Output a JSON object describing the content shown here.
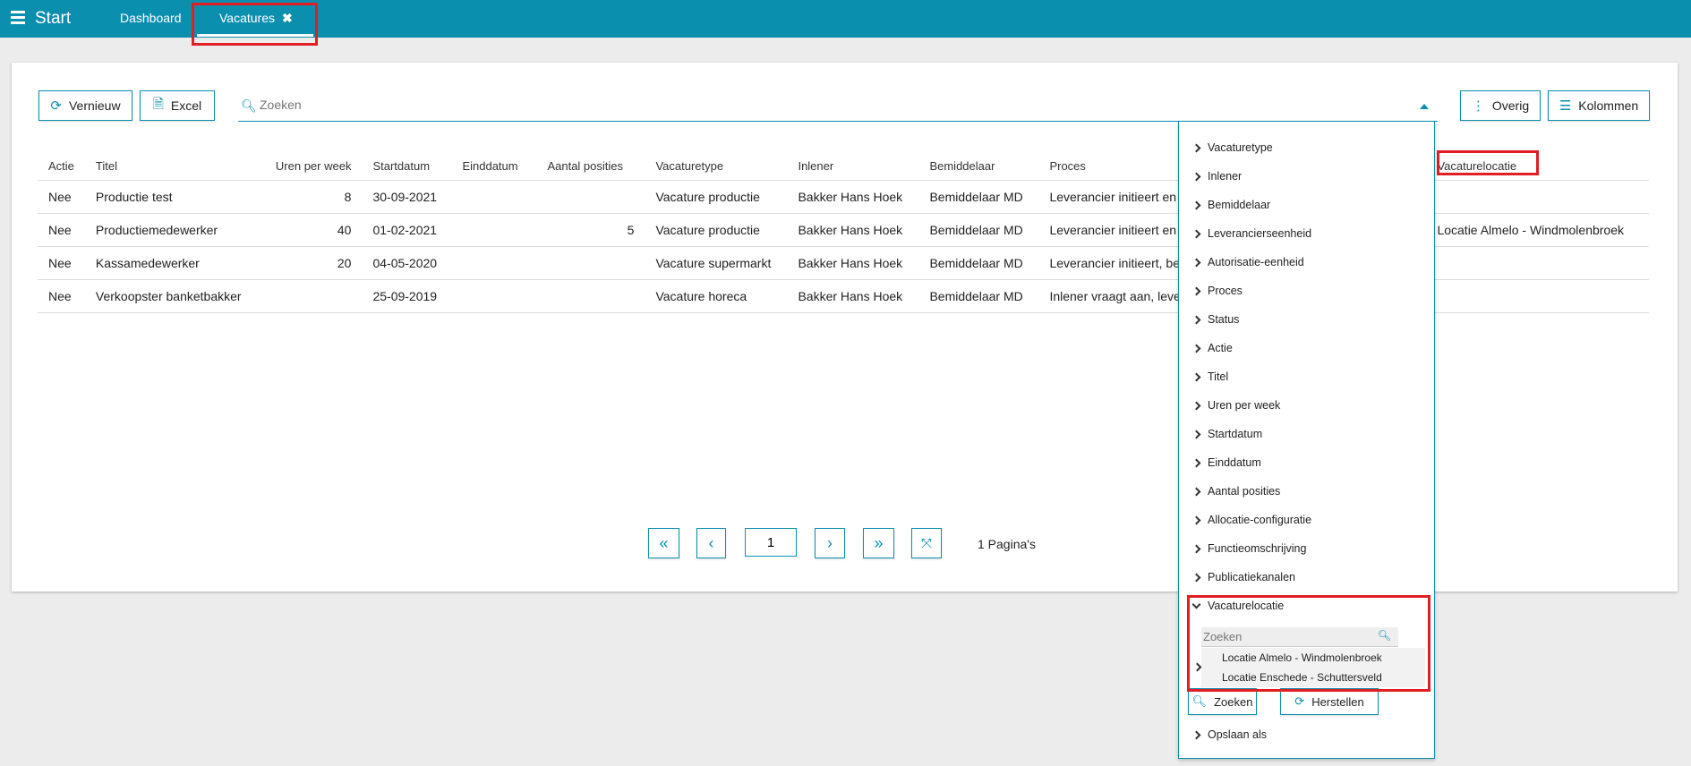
{
  "topbar": {
    "start_label": "Start",
    "tabs": [
      {
        "label": "Dashboard"
      },
      {
        "label": "Vacatures",
        "close": "✖"
      }
    ]
  },
  "toolbar": {
    "refresh_label": "Vernieuw",
    "excel_label": "Excel",
    "search_placeholder": "Zoeken",
    "overig_label": "Overig",
    "kolommen_label": "Kolommen"
  },
  "table": {
    "headers": [
      "Actie",
      "Titel",
      "Uren per week",
      "Startdatum",
      "Einddatum",
      "Aantal posities",
      "Vacaturetype",
      "Inlener",
      "Bemiddelaar",
      "Proces",
      "Vacaturelocatie"
    ],
    "rows": [
      {
        "actie": "Nee",
        "titel": "Productie test",
        "uren": "8",
        "start": "30-09-2021",
        "eind": "",
        "posities": "",
        "type": "Vacature productie",
        "inlener": "Bakker Hans Hoek",
        "bemiddelaar": "Bemiddelaar MD",
        "proces": "Leverancier initieert en",
        "locatie": ""
      },
      {
        "actie": "Nee",
        "titel": "Productiemedewerker",
        "uren": "40",
        "start": "01-02-2021",
        "eind": "",
        "posities": "5",
        "type": "Vacature productie",
        "inlener": "Bakker Hans Hoek",
        "bemiddelaar": "Bemiddelaar MD",
        "proces": "Leverancier initieert en",
        "locatie": "Locatie Almelo - Windmolenbroek"
      },
      {
        "actie": "Nee",
        "titel": "Kassamedewerker",
        "uren": "20",
        "start": "04-05-2020",
        "eind": "",
        "posities": "",
        "type": "Vacature supermarkt",
        "inlener": "Bakker Hans Hoek",
        "bemiddelaar": "Bemiddelaar MD",
        "proces": "Leverancier initieert, be",
        "locatie": ""
      },
      {
        "actie": "Nee",
        "titel": "Verkoopster banketbakker",
        "uren": "",
        "start": "25-09-2019",
        "eind": "",
        "posities": "",
        "type": "Vacature horeca",
        "inlener": "Bakker Hans Hoek",
        "bemiddelaar": "Bemiddelaar MD",
        "proces": "Inlener vraagt aan, leve",
        "locatie": ""
      }
    ]
  },
  "pagination": {
    "current_page": "1",
    "page_count_label": "1 Pagina's"
  },
  "filter_panel": {
    "items": [
      "Vacaturetype",
      "Inlener",
      "Bemiddelaar",
      "Leverancierseenheid",
      "Autorisatie-eenheid",
      "Proces",
      "Status",
      "Actie",
      "Titel",
      "Uren per week",
      "Startdatum",
      "Einddatum",
      "Aantal posities",
      "Allocatie-configuratie",
      "Functieomschrijving",
      "Publicatiekanalen"
    ],
    "expanded_item": "Vacaturelocatie",
    "sub_search_placeholder": "Zoeken",
    "options": [
      "Locatie Almelo - Windmolenbroek",
      "Locatie Enschede - Schuttersveld"
    ],
    "search_button": "Zoeken",
    "reset_button": "Herstellen",
    "save_as": "Opslaan als"
  },
  "colors": {
    "brand": "#0b8fae",
    "highlight": "#e01e24"
  }
}
